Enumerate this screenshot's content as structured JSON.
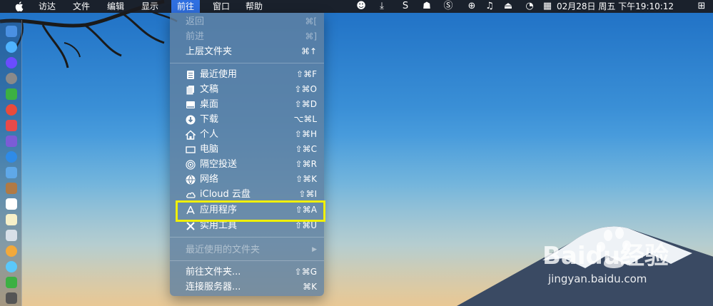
{
  "menubar": {
    "items": [
      "访达",
      "文件",
      "编辑",
      "显示",
      "前往",
      "窗口",
      "帮助"
    ],
    "active_item": "前往",
    "clock": "02月28日 周五 下午19:10:12",
    "status_icons": [
      "qq-icon",
      "download-icon",
      "s-app-icon",
      "ghost-icon",
      "s-app2-icon",
      "globe-icon",
      "music-note-icon",
      "airplay-icon",
      "refresh-icon",
      "calendar-icon"
    ]
  },
  "menu": {
    "items": [
      {
        "label": "返回",
        "shortcut": "⌘[",
        "disabled": true
      },
      {
        "label": "前进",
        "shortcut": "⌘]",
        "disabled": true
      },
      {
        "label": "上层文件夹",
        "shortcut": "⌘↑",
        "disabled": false
      },
      {
        "label": "最近使用",
        "shortcut": "⇧⌘F",
        "icon": "recents-icon"
      },
      {
        "label": "文稿",
        "shortcut": "⇧⌘O",
        "icon": "documents-icon"
      },
      {
        "label": "桌面",
        "shortcut": "⇧⌘D",
        "icon": "desktop-icon"
      },
      {
        "label": "下载",
        "shortcut": "⌥⌘L",
        "icon": "downloads-icon"
      },
      {
        "label": "个人",
        "shortcut": "⇧⌘H",
        "icon": "home-icon"
      },
      {
        "label": "电脑",
        "shortcut": "⇧⌘C",
        "icon": "computer-icon"
      },
      {
        "label": "隔空投送",
        "shortcut": "⇧⌘R",
        "icon": "airdrop-icon"
      },
      {
        "label": "网络",
        "shortcut": "⇧⌘K",
        "icon": "network-icon"
      },
      {
        "label": "iCloud 云盘",
        "shortcut": "⇧⌘I",
        "icon": "icloud-icon"
      },
      {
        "label": "应用程序",
        "shortcut": "⇧⌘A",
        "icon": "applications-icon"
      },
      {
        "label": "实用工具",
        "shortcut": "⇧⌘U",
        "icon": "utilities-icon"
      },
      {
        "label": "最近使用的文件夹",
        "shortcut": "▶",
        "disabled": true
      },
      {
        "label": "前往文件夹...",
        "shortcut": "⇧⌘G"
      },
      {
        "label": "连接服务器...",
        "shortcut": "⌘K"
      }
    ]
  },
  "watermark": {
    "brand": "Baidu经验",
    "url": "jingyan.baidu.com"
  },
  "colors": {
    "menubar": "#1a1a1e",
    "active_menu": "#2f6fe0",
    "highlight_box": "#f0f000"
  }
}
